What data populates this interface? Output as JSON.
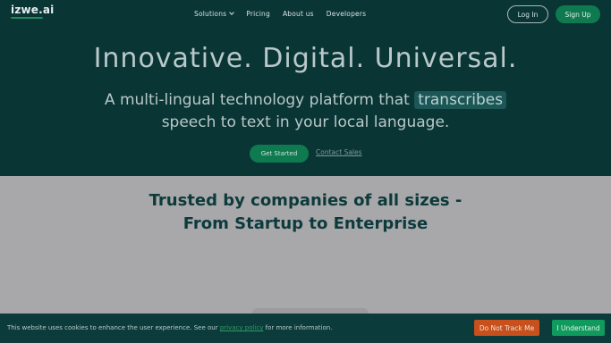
{
  "nav": {
    "logo": "izwe.ai",
    "items": [
      {
        "label": "Solutions",
        "has_dropdown": true
      },
      {
        "label": "Pricing",
        "has_dropdown": false
      },
      {
        "label": "About us",
        "has_dropdown": false
      },
      {
        "label": "Developers",
        "has_dropdown": false
      }
    ],
    "login_label": "Log In",
    "signup_label": "Sign Up"
  },
  "hero": {
    "headline": "Innovative. Digital. Universal.",
    "sub_before": "A multi-lingual technology platform that",
    "sub_highlight": "transcribes",
    "sub_after": "speech to text in your local language.",
    "cta_primary": "Get Started",
    "cta_secondary": "Contact Sales"
  },
  "trusted": {
    "line1": "Trusted by companies of all sizes -",
    "line2": "From Startup to Enterprise"
  },
  "cookie": {
    "text_before": "This website uses cookies to enhance the user experience. See our",
    "link": "privacy policy",
    "text_after": "for more information.",
    "dnt_label": "Do Not Track Me",
    "accept_label": "I Understand"
  },
  "colors": {
    "hero_bg": "#0a3535",
    "brand_green": "#0f7a4f",
    "overlay_gray": "#a8a8ab",
    "dnt_orange": "#c8501c",
    "cookie_bg": "#0c3b3c"
  }
}
